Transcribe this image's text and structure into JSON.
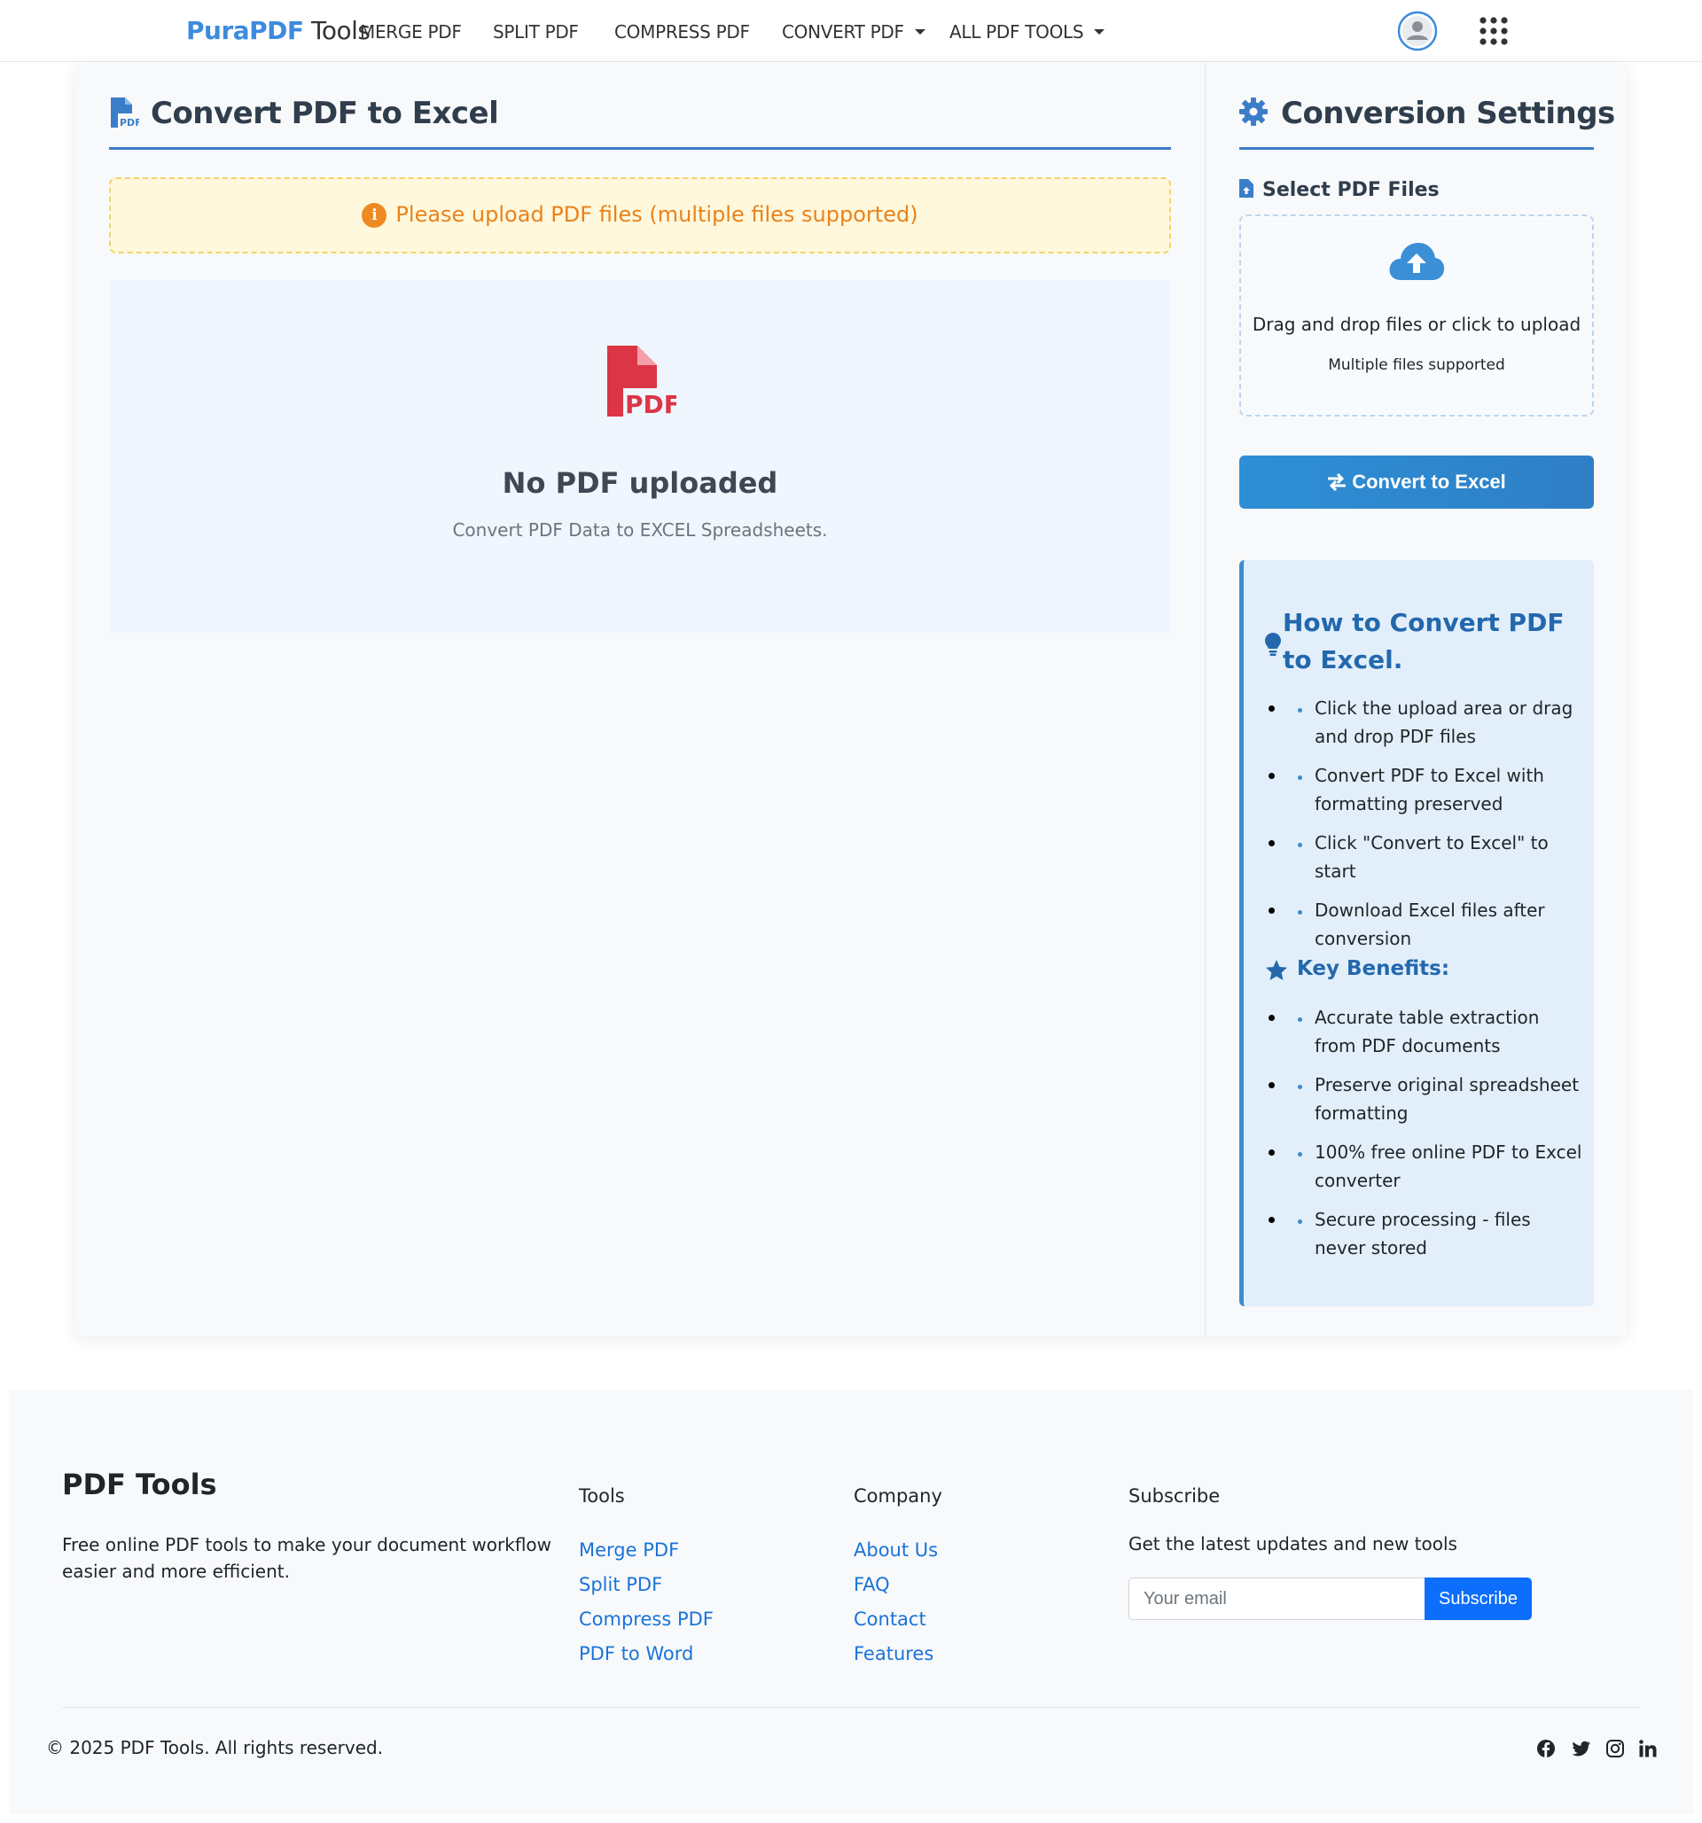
{
  "navbar": {
    "brand_primary": "PuraPDF",
    "brand_secondary": "Tools",
    "links": [
      "MERGE PDF",
      "SPLIT PDF",
      "COMPRESS PDF",
      "CONVERT PDF",
      "ALL PDF TOOLS"
    ]
  },
  "main": {
    "title": "Convert PDF to Excel",
    "alert": "Please upload PDF files (multiple files supported)",
    "empty_title": "No PDF uploaded",
    "empty_subtitle": "Convert PDF Data to EXCEL Spreadsheets.",
    "pdf_icon_label": "PDF"
  },
  "settings": {
    "title": "Conversion Settings",
    "files_label": "Select PDF Files",
    "dropzone_text": "Drag and drop files or click to upload",
    "dropzone_sub": "Multiple files supported",
    "convert_button": "Convert to Excel"
  },
  "howto": {
    "title": "How to Convert PDF to Excel.",
    "steps": [
      "Click the upload area or drag and drop PDF files",
      "Convert PDF to Excel with formatting preserved",
      "Click \"Convert to Excel\" to start",
      "Download Excel files after conversion"
    ],
    "benefits_title": "Key Benefits:",
    "benefits": [
      "Accurate table extraction from PDF documents",
      "Preserve original spreadsheet formatting",
      "100% free online PDF to Excel converter",
      "Secure processing - files never stored"
    ]
  },
  "footer": {
    "brand": "PDF Tools",
    "description": "Free online PDF tools to make your document workflow easier and more efficient.",
    "tools_title": "Tools",
    "tools_links": [
      "Merge PDF",
      "Split PDF",
      "Compress PDF",
      "PDF to Word"
    ],
    "company_title": "Company",
    "company_links": [
      "About Us",
      "FAQ",
      "Contact",
      "Features"
    ],
    "subscribe_title": "Subscribe",
    "subscribe_text": "Get the latest updates and new tools",
    "email_placeholder": "Your email",
    "subscribe_button": "Subscribe",
    "copyright": "© 2025 PDF Tools. All rights reserved.",
    "social_icons": [
      "facebook-icon",
      "twitter-icon",
      "instagram-icon",
      "linkedin-icon"
    ]
  },
  "colors": {
    "brand_blue": "#3d8bde",
    "accent_blue": "#2f7fc5",
    "pdf_red": "#dc3545",
    "alert_orange": "#e9821c"
  }
}
